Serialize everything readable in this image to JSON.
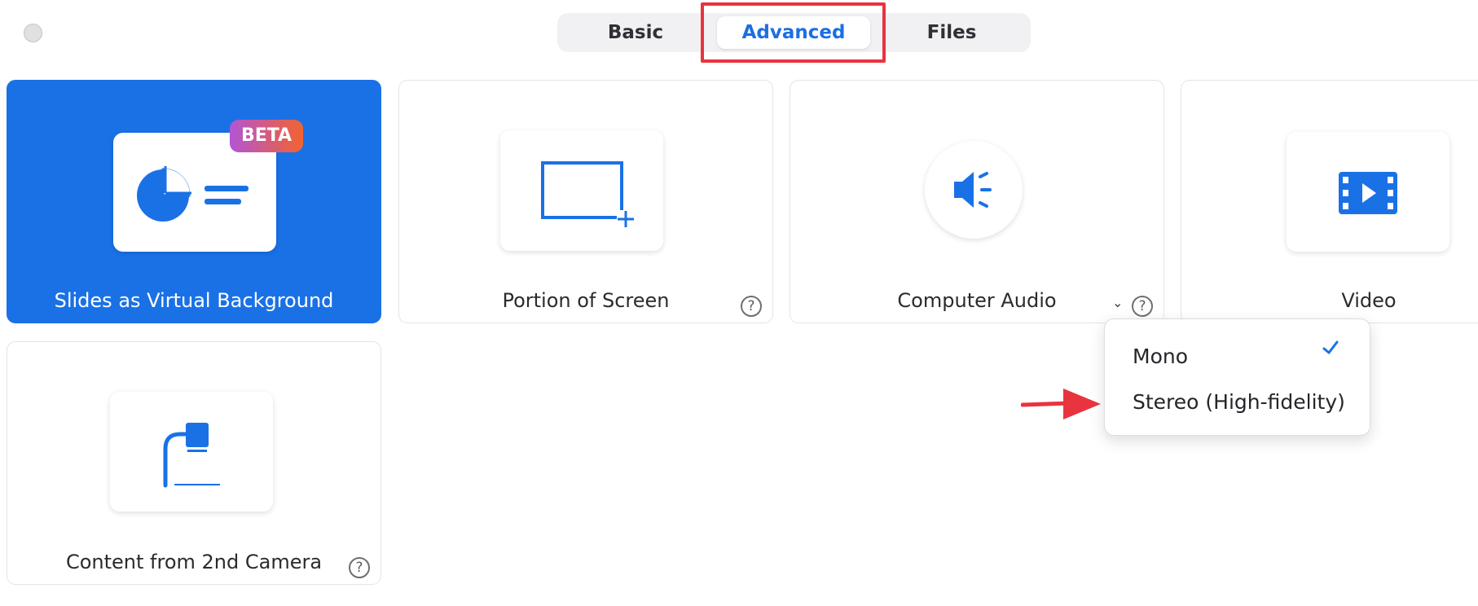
{
  "tabs": [
    {
      "label": "Basic",
      "selected": false
    },
    {
      "label": "Advanced",
      "selected": true
    },
    {
      "label": "Files",
      "selected": false
    }
  ],
  "cards": [
    {
      "label": "Slides as Virtual Background",
      "icon": "slides-icon",
      "badge": "BETA",
      "selected": true
    },
    {
      "label": "Portion of Screen",
      "icon": "screen-portion-icon",
      "help": "?"
    },
    {
      "label": "Computer Audio",
      "icon": "speaker-icon",
      "help": "?",
      "dropdown": "⌄"
    },
    {
      "label": "Video",
      "icon": "video-icon"
    },
    {
      "label": "Content from 2nd Camera",
      "icon": "camera-icon",
      "help": "?"
    }
  ],
  "audio_menu": {
    "items": [
      {
        "label": "Mono",
        "checked": true
      },
      {
        "label": "Stereo (High-fidelity)",
        "checked": false
      }
    ]
  },
  "colors": {
    "accent": "#1a71e6",
    "highlight": "#e8343f",
    "beta_gradient": [
      "#b255d6",
      "#f2632f"
    ]
  }
}
